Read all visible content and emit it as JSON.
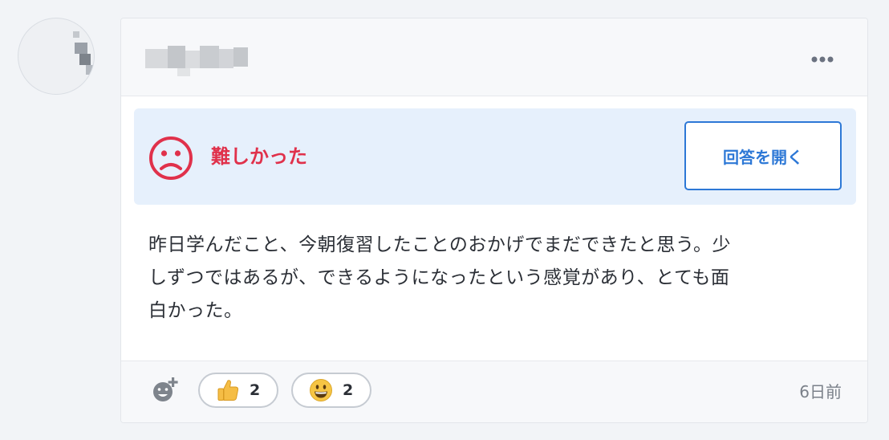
{
  "post": {
    "menu_icon": "more-horizontal-icon",
    "result": {
      "icon": "sad-face-icon",
      "label": "難しかった",
      "color": "#e0314b"
    },
    "open_answer_label": "回答を開く",
    "body_lines": [
      "昨日学んだこと、今朝復習したことのおかげでまだできたと思う。少",
      "しずつではあるが、できるようになったという感覚があり、とても面",
      "白かった。"
    ],
    "reactions": [
      {
        "icon": "thumbs-up-icon",
        "count": "2"
      },
      {
        "icon": "grinning-face-icon",
        "count": "2"
      }
    ],
    "add_reaction_icon": "add-reaction-icon",
    "time": "6日前"
  },
  "colors": {
    "accent": "#2d78d6",
    "result_bg": "#e6f0fc",
    "difficult": "#e0314b"
  }
}
